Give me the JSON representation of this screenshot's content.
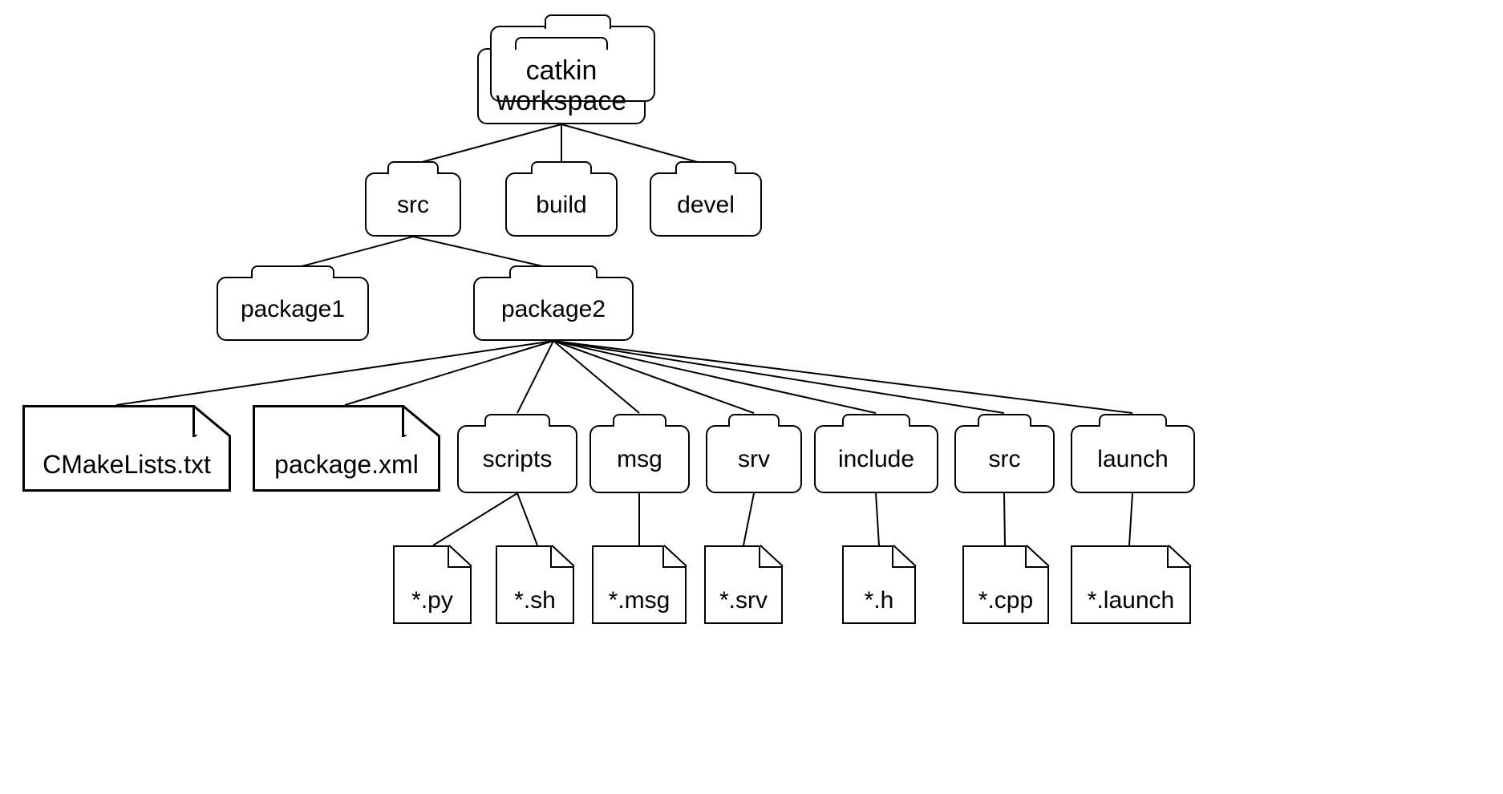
{
  "root": {
    "label": "catkin\nworkspace"
  },
  "level2": {
    "src": "src",
    "build": "build",
    "devel": "devel"
  },
  "level3": {
    "package1": "package1",
    "package2": "package2"
  },
  "level4_files": {
    "cmake": "CMakeLists.txt",
    "pkgxml": "package.xml"
  },
  "level4_folders": {
    "scripts": "scripts",
    "msg": "msg",
    "srv": "srv",
    "include": "include",
    "src": "src",
    "launch": "launch"
  },
  "level5_files": {
    "py": "*.py",
    "sh": "*.sh",
    "msg": "*.msg",
    "srv": "*.srv",
    "h": "*.h",
    "cpp": "*.cpp",
    "launch": "*.launch"
  }
}
